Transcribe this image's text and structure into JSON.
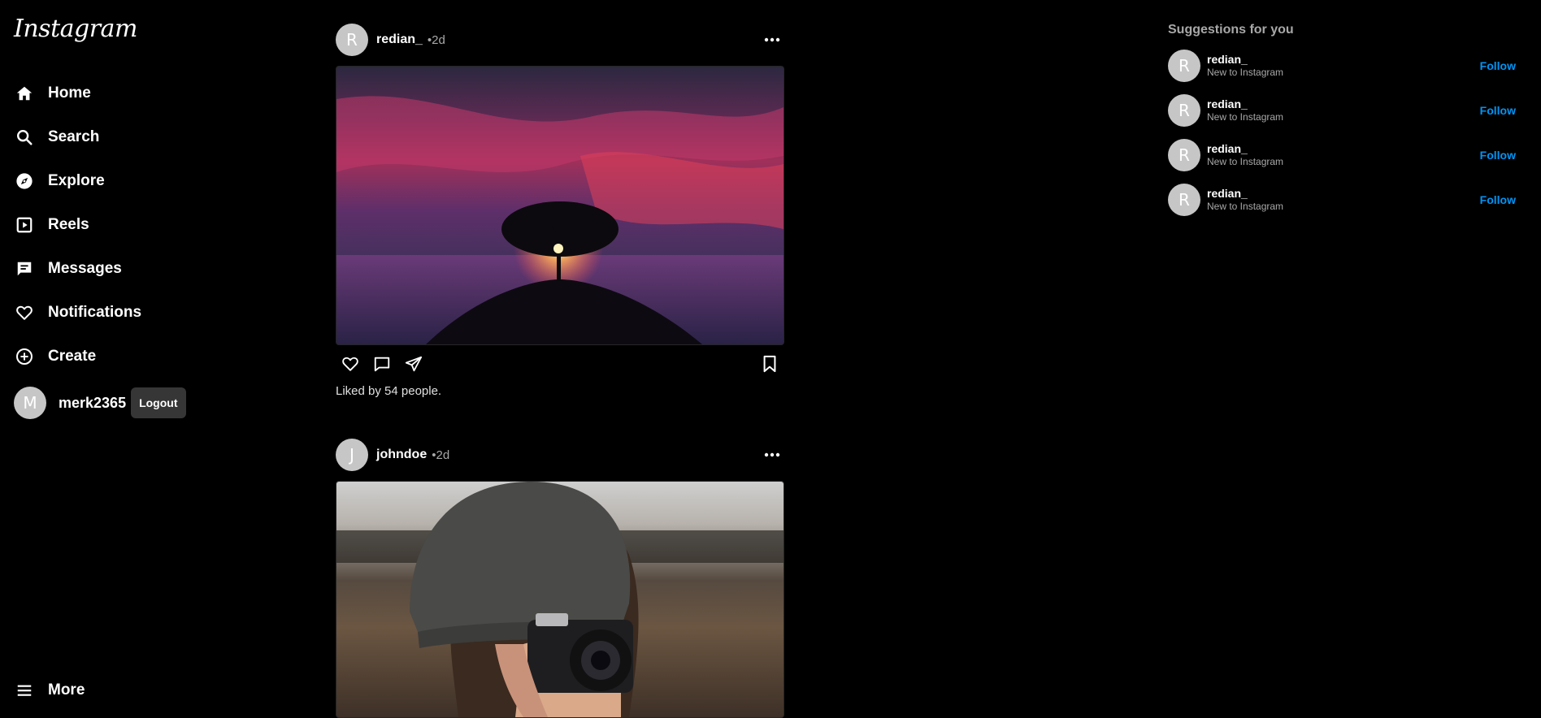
{
  "app": {
    "logo": "Instagram"
  },
  "sidebar": {
    "items": [
      {
        "label": "Home",
        "icon": "home-icon"
      },
      {
        "label": "Search",
        "icon": "search-icon"
      },
      {
        "label": "Explore",
        "icon": "compass-icon"
      },
      {
        "label": "Reels",
        "icon": "reels-icon"
      },
      {
        "label": "Messages",
        "icon": "messages-icon"
      },
      {
        "label": "Notifications",
        "icon": "heart-icon"
      },
      {
        "label": "Create",
        "icon": "plus-circle-icon"
      }
    ],
    "profile": {
      "initial": "M",
      "username": "merk2365",
      "logout_label": "Logout"
    },
    "more_label": "More"
  },
  "feed": {
    "posts": [
      {
        "initial": "R",
        "username": "redian_",
        "time": "•2d",
        "likes": "Liked by 54 people."
      },
      {
        "initial": "J",
        "username": "johndoe",
        "time": "•2d"
      }
    ]
  },
  "suggestions": {
    "title": "Suggestions for you",
    "items": [
      {
        "initial": "R",
        "name": "redian_",
        "subtitle": "New to Instagram",
        "action": "Follow"
      },
      {
        "initial": "R",
        "name": "redian_",
        "subtitle": "New to Instagram",
        "action": "Follow"
      },
      {
        "initial": "R",
        "name": "redian_",
        "subtitle": "New to Instagram",
        "action": "Follow"
      },
      {
        "initial": "R",
        "name": "redian_",
        "subtitle": "New to Instagram",
        "action": "Follow"
      }
    ]
  },
  "colors": {
    "background": "#000000",
    "accent": "#0095f6",
    "muted": "#a8a8a8",
    "avatar": "#c6c6c6"
  }
}
